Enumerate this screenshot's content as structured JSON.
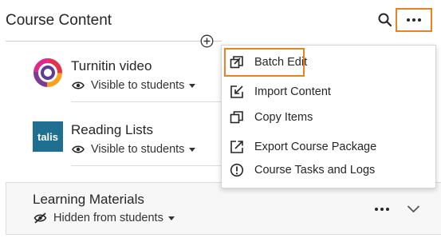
{
  "header": {
    "title": "Course Content"
  },
  "items": [
    {
      "title": "Turnitin video",
      "visibility": "Visible to students"
    },
    {
      "title": "Reading Lists",
      "logo_text": "talis",
      "visibility": "Visible to students"
    }
  ],
  "folder": {
    "title": "Learning Materials",
    "visibility": "Hidden from students"
  },
  "menu": {
    "items": [
      {
        "label": "Batch Edit",
        "icon": "batch-edit-icon"
      },
      {
        "label": "Import Content",
        "icon": "import-icon"
      },
      {
        "label": "Copy Items",
        "icon": "copy-icon"
      },
      {
        "label": "Export Course Package",
        "icon": "export-icon"
      },
      {
        "label": "Course Tasks and Logs",
        "icon": "info-circle-icon"
      }
    ]
  },
  "colors": {
    "highlight": "#e8831f",
    "talis": "#1f6f93"
  }
}
